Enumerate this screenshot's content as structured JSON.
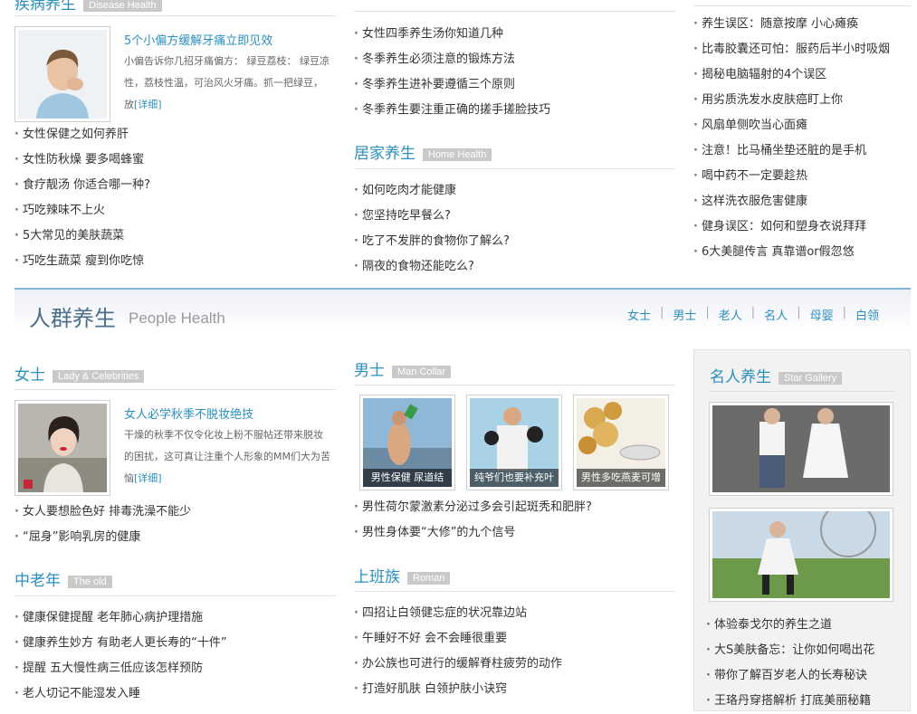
{
  "top_left": {
    "title": "疾病养生",
    "tag": "Disease Health",
    "feature": {
      "title": "5个小偏方缓解牙痛立即见效",
      "desc": "小偏告诉你几招牙痛偏方： 绿豆荔枝： 绿豆凉性，荔枝性温，可治风火牙痛。抓一把绿豆，放",
      "more": "[详细]"
    },
    "list": [
      "女性保健之如何养肝",
      "女性防秋燥 要多喝蜂蜜",
      "食疗靓汤 你适合哪一种?",
      "巧吃辣味不上火",
      "5大常见的美肤蔬菜",
      "巧吃生蔬菜 瘦到你吃惊"
    ]
  },
  "top_middle": {
    "list": [
      "女性四季养生汤你知道几种",
      "冬季养生必须注意的锻炼方法",
      "冬季养生进补要遵循三个原则",
      "冬季养生要注重正确的搓手搓脸技巧"
    ],
    "home": {
      "title": "居家养生",
      "tag": "Home Health",
      "list": [
        "如何吃肉才能健康",
        "您坚持吃早餐么?",
        "吃了不发胖的食物你了解么?",
        "隔夜的食物还能吃么?"
      ]
    }
  },
  "top_right": {
    "list": [
      "养生误区：随意按摩 小心瘫痪",
      "比毒胶囊还可怕：服药后半小时吸烟",
      "揭秘电脑辐射的4个误区",
      "用劣质洗发水皮肤癌盯上你",
      "风扇单侧吹当心面瘫",
      "注意！比马桶坐垫还脏的是手机",
      "喝中药不一定要趁热",
      "这样洗衣服危害健康",
      "健身误区：如何和塑身衣说拜拜",
      "6大美腿传言 真靠谱or假忽悠"
    ]
  },
  "banner": {
    "title": "人群养生",
    "subtitle": "People Health",
    "nav": [
      "女士",
      "男士",
      "老人",
      "名人",
      "母婴",
      "白领"
    ]
  },
  "women": {
    "title": "女士",
    "tag": "Lady & Celebrities",
    "feature": {
      "title": "女人必学秋季不脱妆绝技",
      "desc": "干燥的秋季不仅令化妆上粉不服帖还带来脱妆的困扰，这可真让注重个人形象的MM们大为苦恼",
      "more": "[详细]"
    },
    "list": [
      "女人要想脸色好 排毒洗澡不能少",
      "“屈身”影响乳房的健康"
    ]
  },
  "elderly": {
    "title": "中老年",
    "tag": "The old",
    "list": [
      "健康保健提醒 老年肺心病护理措施",
      "健康养生妙方 有助老人更长寿的“十件”",
      "提醒 五大慢性病三低应该怎样预防",
      "老人切记不能湿发入睡"
    ]
  },
  "men": {
    "title": "男士",
    "tag": "Man Collar",
    "thumbs": [
      "男性保健 尿道结",
      "纯爷们也要补充叶",
      "男性多吃燕麦可增"
    ],
    "list": [
      "男性荷尔蒙激素分泌过多会引起斑秃和肥胖?",
      "男性身体要“大修”的九个信号"
    ]
  },
  "office": {
    "title": "上班族",
    "tag": "Roman",
    "list": [
      "四招让白领健忘症的状况靠边站",
      "午睡好不好 会不会睡很重要",
      "办公族也可进行的缓解脊柱疲劳的动作",
      "打造好肌肤 白领护肤小诀窍"
    ]
  },
  "celeb": {
    "title": "名人养生",
    "tag": "Star Gallery",
    "list": [
      "体验泰戈尔的养生之道",
      "大S美肤备忘：让你如何喝出花",
      "带你了解百岁老人的长寿秘诀",
      "王珞丹穿搭解析 打底美丽秘籍"
    ]
  },
  "colors": {
    "accent": "#2b8fbe",
    "tag_bg": "#c9c9c9",
    "banner_line": "#7fb6d6"
  }
}
